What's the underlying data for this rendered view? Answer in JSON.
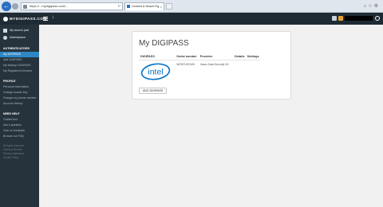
{
  "browser": {
    "url": "https://...mydigipass.com/...",
    "tab_title": "Connect & Secure Fig..."
  },
  "header": {
    "logo_text": "MYDIGIPASS.COM"
  },
  "sidebar": {
    "top_items": [
      {
        "label": "My launch pad",
        "icon": "grid-icon"
      },
      {
        "label": "Marketplace",
        "icon": "globe-icon"
      }
    ],
    "sections": [
      {
        "heading": "AUTHENTICATORS",
        "items": [
          {
            "label": "My DIGIPASS",
            "active": true
          },
          {
            "label": "Add DIGIPASS",
            "active": false
          },
          {
            "label": "My Backup DIGIPASS",
            "active": false
          },
          {
            "label": "My Registered Devices",
            "active": false
          }
        ]
      },
      {
        "heading": "PROFILE",
        "items": [
          {
            "label": "Personal information",
            "active": false
          },
          {
            "label": "Change master key",
            "active": false
          },
          {
            "label": "Change my phone number",
            "active": false
          },
          {
            "label": "Account History",
            "active": false
          }
        ]
      },
      {
        "heading": "NEED HELP",
        "items": [
          {
            "label": "Guided tour",
            "active": false
          },
          {
            "label": "Ask a question",
            "active": false
          },
          {
            "label": "Give us feedback",
            "active": false
          },
          {
            "label": "Browse our FAQ",
            "active": false
          }
        ]
      }
    ],
    "footer": [
      "All rights reserved",
      "Terms of Service",
      "Privacy Statement",
      "Cookie Policy"
    ]
  },
  "card": {
    "title": "My DIGIPASS",
    "columns": [
      "DIGIPASS",
      "Serial number",
      "Provider",
      "Details",
      "Settings"
    ],
    "rows": [
      {
        "logo": "intel",
        "serial": "WEDFHZCWN",
        "provider": "Vasco Data Security NV",
        "details": "",
        "settings": ""
      }
    ],
    "add_button": "ADD DIGIPASS"
  },
  "colors": {
    "header_bg": "#1f2b34",
    "sidebar_bg": "#26333d",
    "active_item": "#2f86c4",
    "intel_blue": "#0071c5"
  }
}
